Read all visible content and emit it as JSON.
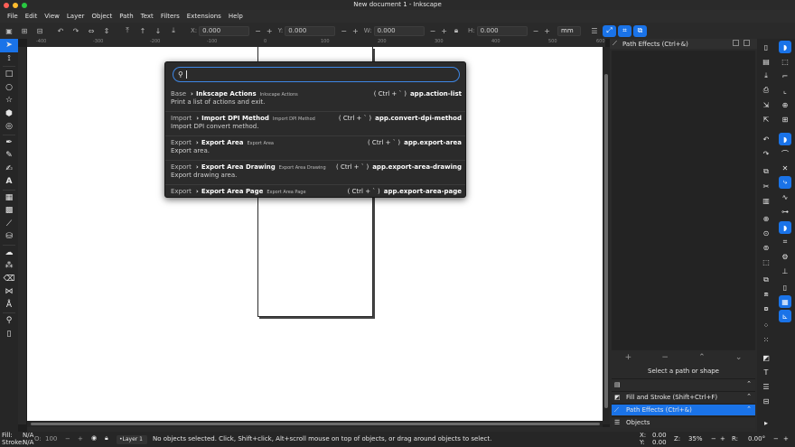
{
  "window": {
    "title": "New document 1 - Inkscape"
  },
  "menu": [
    "File",
    "Edit",
    "View",
    "Layer",
    "Object",
    "Path",
    "Text",
    "Filters",
    "Extensions",
    "Help"
  ],
  "toolbar": {
    "x_label": "X:",
    "x_value": "0.000",
    "y_label": "Y:",
    "y_value": "0.000",
    "w_label": "W:",
    "w_value": "0.000",
    "h_label": "H:",
    "h_value": "0.000",
    "unit": "mm",
    "minus": "−",
    "plus": "+"
  },
  "ruler": {
    "ticks": [
      "-400",
      "-300",
      "-200",
      "-100",
      "0",
      "100",
      "200",
      "300",
      "400",
      "500",
      "600"
    ]
  },
  "command_palette": {
    "search_value": "",
    "items": [
      {
        "category": "Base",
        "name": "Inkscape Actions",
        "untranslated": "Inkscape Actions",
        "shortcut": "( Ctrl + ` )",
        "id": "app.action-list",
        "description": "Print a list of actions and exit."
      },
      {
        "category": "Import",
        "name": "Import DPI Method",
        "untranslated": "Import DPI Method",
        "shortcut": "( Ctrl + ` )",
        "id": "app.convert-dpi-method",
        "description": "Import DPI convert method."
      },
      {
        "category": "Export",
        "name": "Export Area",
        "untranslated": "Export Area",
        "shortcut": "( Ctrl + ` )",
        "id": "app.export-area",
        "description": "Export area."
      },
      {
        "category": "Export",
        "name": "Export Area Drawing",
        "untranslated": "Export Area Drawing",
        "shortcut": "( Ctrl + ` )",
        "id": "app.export-area-drawing",
        "description": "Export drawing area."
      },
      {
        "category": "Export",
        "name": "Export Area Page",
        "untranslated": "Export Area Page",
        "shortcut": "( Ctrl + ` )",
        "id": "app.export-area-page",
        "description": ""
      }
    ]
  },
  "dock": {
    "title": "Path Effects (Ctrl+&)",
    "hint": "Select a path or shape",
    "tabs": [
      {
        "label": "",
        "icon": "document-icon"
      },
      {
        "label": "Fill and Stroke (Shift+Ctrl+F)",
        "icon": "fill-stroke-icon"
      },
      {
        "label": "Path Effects (Ctrl+&)",
        "icon": "path-effects-icon"
      },
      {
        "label": "Objects",
        "icon": "objects-icon"
      }
    ]
  },
  "status": {
    "fill_label": "Fill:",
    "fill_value": "N/A",
    "stroke_label": "Stroke:",
    "stroke_value": "N/A",
    "opacity_label": "O:",
    "opacity_value": "100",
    "layer": "•Layer 1",
    "message": "No objects selected. Click, Shift+click, Alt+scroll mouse on top of objects, or drag around objects to select.",
    "x_label": "X:",
    "x_value": "0.00",
    "y_label": "Y:",
    "y_value": "0.00",
    "zoom_label": "Z:",
    "zoom_value": "35%",
    "rotate_label": "R:",
    "rotate_value": "0.00°"
  },
  "colors": {
    "accent": "#1a73e8",
    "background": "#2a2a2a",
    "canvas": "#ffffff"
  }
}
